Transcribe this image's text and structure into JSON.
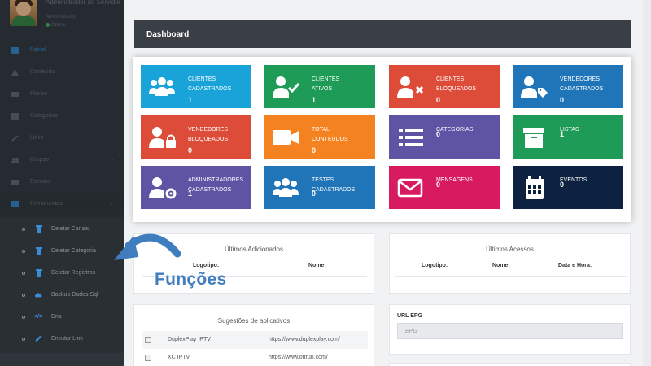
{
  "sidebar": {
    "profile": {
      "name": "Administrador do Servidor",
      "role": "Administrador",
      "status": "Online"
    },
    "menu": [
      {
        "label": "Painel",
        "icon": "dashboard-icon",
        "active": true
      },
      {
        "label": "Conteúdo",
        "icon": "content-icon"
      },
      {
        "label": "Planos",
        "icon": "plans-icon"
      },
      {
        "label": "Categorias",
        "icon": "categories-icon"
      },
      {
        "label": "Links",
        "icon": "links-icon"
      },
      {
        "label": "Grupos",
        "icon": "groups-icon",
        "caret": true
      },
      {
        "label": "Eventos",
        "icon": "events-icon"
      },
      {
        "label": "Ferramentas",
        "icon": "tools-icon",
        "caret": true
      }
    ],
    "submenu": [
      {
        "label": "Deletar Canais",
        "icon": "trash-icon"
      },
      {
        "label": "Deletar Categoria",
        "icon": "trash-icon"
      },
      {
        "label": "Deletar Registros",
        "icon": "trash-icon"
      },
      {
        "label": "Backup Dados Sql",
        "icon": "cloud-icon"
      },
      {
        "label": "Dns",
        "icon": "code-icon"
      },
      {
        "label": "Encutar Link",
        "icon": "link-icon"
      }
    ]
  },
  "header": {
    "title": "Dashboard"
  },
  "tiles": [
    {
      "label1": "CLIENTES",
      "label2": "CADASTRADOS",
      "count": "1",
      "color": "#1aa3d9",
      "icon": "users-icon"
    },
    {
      "label1": "CLIENTES",
      "label2": "ATIVOS",
      "count": "1",
      "color": "#1e9c57",
      "icon": "user-check-icon"
    },
    {
      "label1": "CLIENTES",
      "label2": "BLOQUEADOS",
      "count": "0",
      "color": "#dd4b39",
      "icon": "user-times-icon"
    },
    {
      "label1": "VENDEDORES",
      "label2": "CADASTRADOS",
      "count": "0",
      "color": "#1f75b8",
      "icon": "user-tag-icon"
    },
    {
      "label1": "VENDEDORES",
      "label2": "BLOQUEADOS",
      "count": "0",
      "color": "#dd4b39",
      "icon": "user-lock-icon"
    },
    {
      "label1": "TOTAL",
      "label2": "CONTEÚDOS",
      "count": "0",
      "color": "#f58220",
      "icon": "video-icon"
    },
    {
      "label1": "CATEGORIAS",
      "label2": "",
      "count": "0",
      "color": "#5d55a4",
      "icon": "list-icon"
    },
    {
      "label1": "LISTAS",
      "label2": "",
      "count": "1",
      "color": "#1e9c57",
      "icon": "archive-icon"
    },
    {
      "label1": "ADMINISTRADORES",
      "label2": "CADASTRADOS",
      "count": "1",
      "color": "#5d55a4",
      "icon": "user-cog-icon"
    },
    {
      "label1": "TESTES",
      "label2": "CADASTRADOS",
      "count": "0",
      "color": "#1f75b8",
      "icon": "users-icon"
    },
    {
      "label1": "MENSAGENS",
      "label2": "",
      "count": "0",
      "color": "#d81b60",
      "icon": "envelope-icon"
    },
    {
      "label1": "EVENTOS",
      "label2": "",
      "count": "0",
      "color": "#0d2140",
      "icon": "calendar-icon"
    }
  ],
  "recent_added": {
    "title": "Últimos Adicionados",
    "col_logo": "Logotipo:",
    "col_name": "Nome:"
  },
  "recent_access": {
    "title": "Últimos Acessos",
    "col_logo": "Logotipo:",
    "col_name": "Nome:",
    "col_date": "Data e Hora:"
  },
  "apps": {
    "title": "Sugestões de aplicativos",
    "rows": [
      {
        "name": "DuplexPlay IPTV",
        "url": "https://www.duplexplay.com/"
      },
      {
        "name": "XC IPTV",
        "url": "https://www.ottrun.com/"
      }
    ]
  },
  "epg": {
    "label": "URL EPG",
    "placeholder": "EPG"
  },
  "annotation": {
    "text": "Funções"
  }
}
